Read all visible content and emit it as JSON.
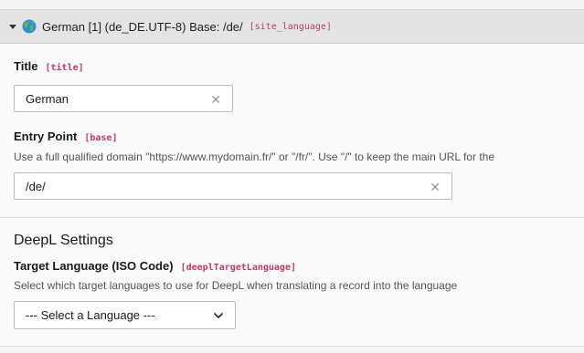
{
  "header": {
    "title": "German [1] (de_DE.UTF-8) Base: /de/",
    "identifier": "[site_language]"
  },
  "fields": {
    "title": {
      "label": "Title",
      "identifier": "[title]",
      "value": "German"
    },
    "entry_point": {
      "label": "Entry Point",
      "identifier": "[base]",
      "description": "Use a full qualified domain \"https://www.mydomain.fr/\" or \"/fr/\". Use \"/\" to keep the main URL for the",
      "value": "/de/"
    }
  },
  "deepl": {
    "heading": "DeepL Settings",
    "target_language": {
      "label": "Target Language (ISO Code)",
      "identifier": "[deeplTargetLanguage]",
      "description": "Select which target languages to use for DeepL when translating a record into the language",
      "selected": "--- Select a Language ---"
    }
  },
  "icons": {
    "collapse": "caret-down-icon",
    "language": "globe-icon",
    "clear": "close-icon",
    "dropdown": "chevron-down-icon"
  },
  "colors": {
    "identifier": "#c0396b",
    "header_bg": "#e4e4e4"
  }
}
